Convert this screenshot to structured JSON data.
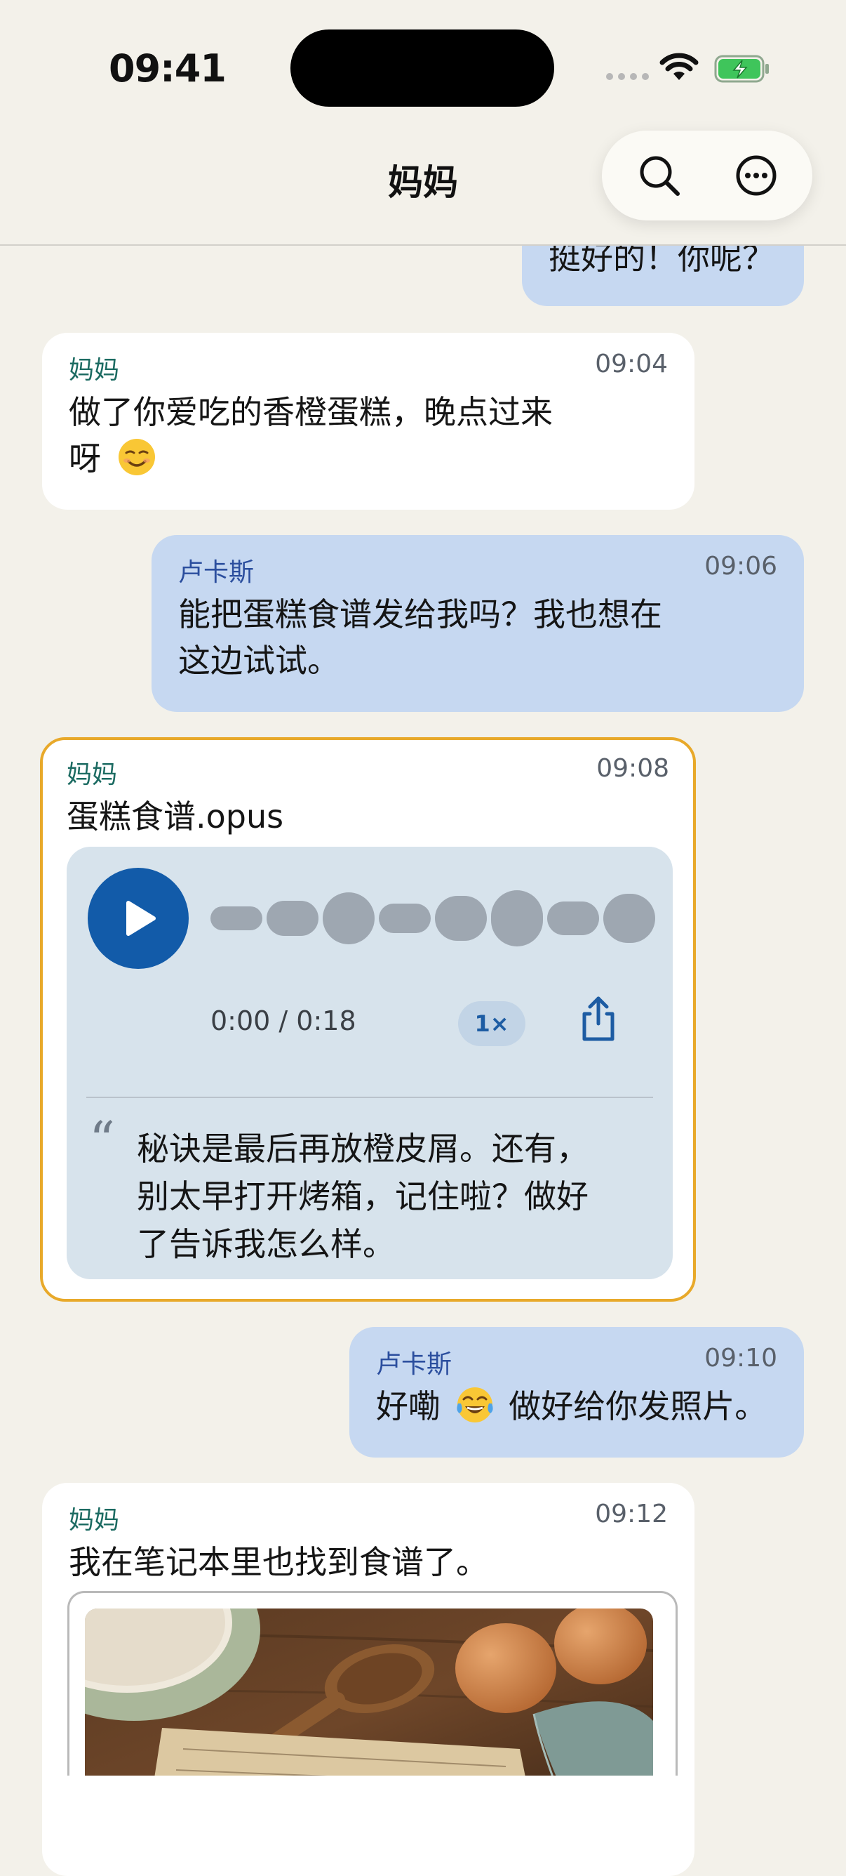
{
  "status_bar": {
    "time": "09:41"
  },
  "header": {
    "title": "妈妈"
  },
  "messages": [
    {
      "text": "挺好的！你呢？"
    },
    {
      "sender": "妈妈",
      "time": "09:04",
      "line1": "做了你爱吃的香橙蛋糕，晚点过来",
      "line2": "呀",
      "emoji": "smiling-face-emoji"
    },
    {
      "sender": "卢卡斯",
      "time": "09:06",
      "line1": "能把蛋糕食谱发给我吗？我也想在",
      "line2": "这边试试。"
    },
    {
      "sender": "妈妈",
      "time": "09:08",
      "filename": "蛋糕食谱.opus",
      "audio": {
        "progress": "0:00 / 0:18",
        "speed": "1×",
        "transcript_line1": "秘诀是最后再放橙皮屑。还有，",
        "transcript_line2": "别太早打开烤箱，记住啦？做好",
        "transcript_line3": "了告诉我怎么样。"
      }
    },
    {
      "sender": "卢卡斯",
      "time": "09:10",
      "text_a": "好嘞",
      "text_b": "做好给你发照片。",
      "emoji": "tears-of-joy-emoji"
    },
    {
      "sender": "妈妈",
      "time": "09:12",
      "text": "我在笔记本里也找到食谱了。"
    }
  ],
  "colors": {
    "accent": "#125ba9",
    "outgoing": "#c6d8f1",
    "incoming": "#ffffff",
    "highlight": "#e8a92a",
    "background": "#f3f1ea"
  }
}
